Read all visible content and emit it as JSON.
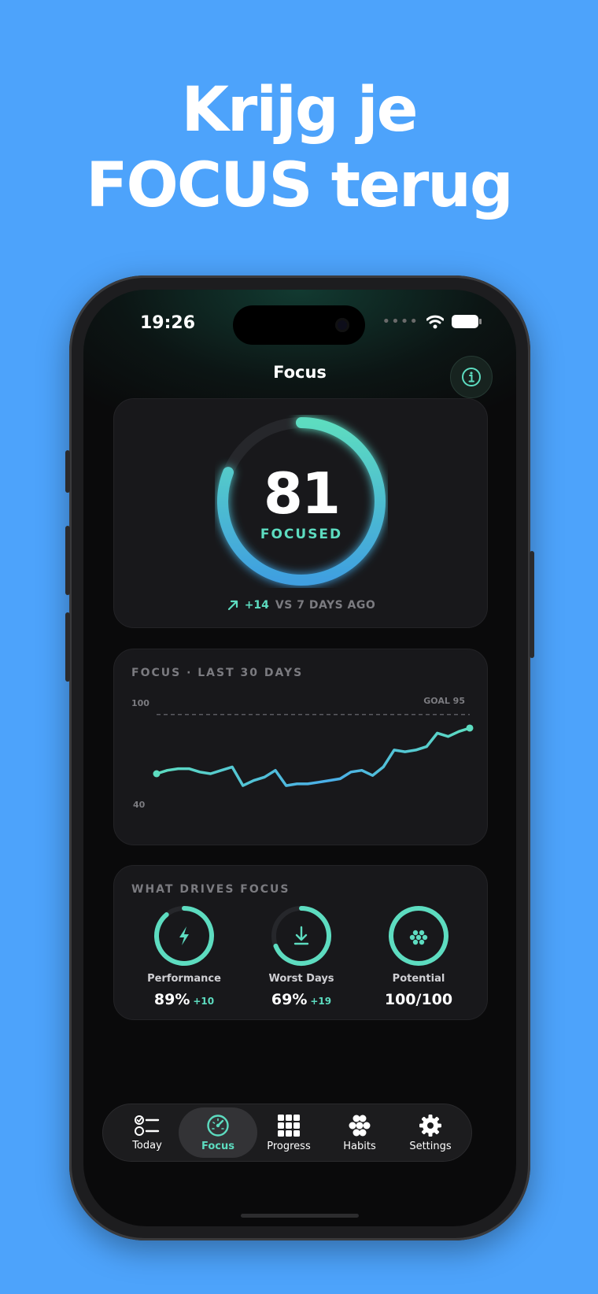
{
  "headline": {
    "line1": "Krijg je",
    "line2": "FOCUS terug"
  },
  "status_bar": {
    "time": "19:26"
  },
  "nav": {
    "title": "Focus",
    "info_icon": "info-icon"
  },
  "score_card": {
    "score": "81",
    "score_fraction": 0.81,
    "label": "FOCUSED",
    "delta": "+14",
    "delta_text": "VS 7 DAYS AGO",
    "delta_icon": "arrow-up-right-icon"
  },
  "trend_card": {
    "title": "FOCUS · LAST 30 DAYS",
    "goal_label": "GOAL 95",
    "chart_data": {
      "type": "line",
      "title": "FOCUS · LAST 30 DAYS",
      "y_ticks": [
        "100",
        "40"
      ],
      "ylim": [
        40,
        100
      ],
      "goal": 95,
      "grid": false,
      "series": [
        {
          "values": [
            60,
            62,
            63,
            63,
            61,
            60,
            62,
            64,
            53,
            56,
            58,
            62,
            53,
            54,
            54,
            55,
            56,
            57,
            61,
            62,
            59,
            64,
            74,
            73,
            74,
            76,
            84,
            82,
            85,
            87
          ]
        }
      ]
    }
  },
  "drivers_card": {
    "title": "WHAT DRIVES FOCUS",
    "items": [
      {
        "label": "Performance",
        "value": "89%",
        "delta": "+10",
        "fraction": 0.89,
        "icon": "lightning-icon"
      },
      {
        "label": "Worst Days",
        "value": "69%",
        "delta": "+19",
        "fraction": 0.69,
        "icon": "download-arrow-icon"
      },
      {
        "label": "Potential",
        "value": "100/100",
        "delta": "",
        "fraction": 1.0,
        "icon": "dots-cluster-icon"
      }
    ]
  },
  "tabbar": {
    "tabs": [
      {
        "label": "Today",
        "icon": "checklist-icon"
      },
      {
        "label": "Focus",
        "icon": "gauge-icon"
      },
      {
        "label": "Progress",
        "icon": "grid-icon"
      },
      {
        "label": "Habits",
        "icon": "flower-icon"
      },
      {
        "label": "Settings",
        "icon": "gear-icon"
      }
    ],
    "active": "Focus"
  },
  "colors": {
    "accent": "#5ddcc0",
    "accent_blue": "#4aaee8",
    "background": "#4da3fb"
  }
}
